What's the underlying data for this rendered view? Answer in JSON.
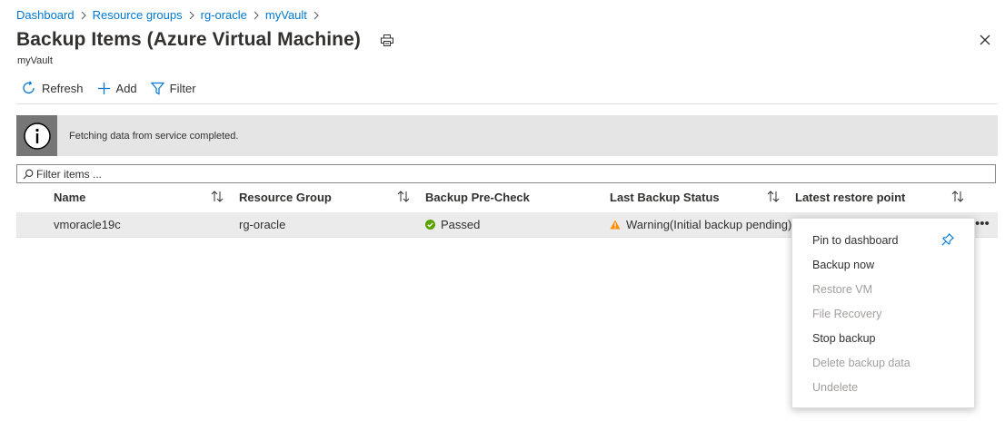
{
  "breadcrumb": {
    "items": [
      "Dashboard",
      "Resource groups",
      "rg-oracle",
      "myVault"
    ]
  },
  "header": {
    "title": "Backup Items (Azure Virtual Machine)",
    "subtitle": "myVault"
  },
  "toolbar": {
    "refresh_label": "Refresh",
    "add_label": "Add",
    "filter_label": "Filter"
  },
  "info": {
    "message": "Fetching data from service completed."
  },
  "filter": {
    "placeholder": "Filter items ..."
  },
  "table": {
    "columns": [
      "Name",
      "Resource Group",
      "Backup Pre-Check",
      "Last Backup Status",
      "Latest restore point"
    ],
    "rows": [
      {
        "name": "vmoracle19c",
        "resource_group": "rg-oracle",
        "precheck": "Passed",
        "last_backup_status": "Warning(Initial backup pending)",
        "more": "•••"
      }
    ]
  },
  "context_menu": {
    "items": [
      {
        "label": "Pin to dashboard",
        "enabled": true
      },
      {
        "label": "Backup now",
        "enabled": true
      },
      {
        "label": "Restore VM",
        "enabled": false
      },
      {
        "label": "File Recovery",
        "enabled": false
      },
      {
        "label": "Stop backup",
        "enabled": true
      },
      {
        "label": "Delete backup data",
        "enabled": false
      },
      {
        "label": "Undelete",
        "enabled": false
      }
    ]
  },
  "icons": {
    "print": "print-icon",
    "close": "close-icon",
    "refresh": "refresh-icon",
    "add": "add-icon",
    "filter": "filter-icon",
    "info": "info-icon",
    "search": "search-icon",
    "sort": "sort-icon",
    "success": "check-circle-icon",
    "warning": "warning-icon",
    "pin": "pin-icon"
  },
  "colors": {
    "link": "#0078d4",
    "success": "#57a300",
    "warning": "#ff8c00",
    "info_bar": "#e5e5e5",
    "info_icon_bg": "#767676"
  }
}
